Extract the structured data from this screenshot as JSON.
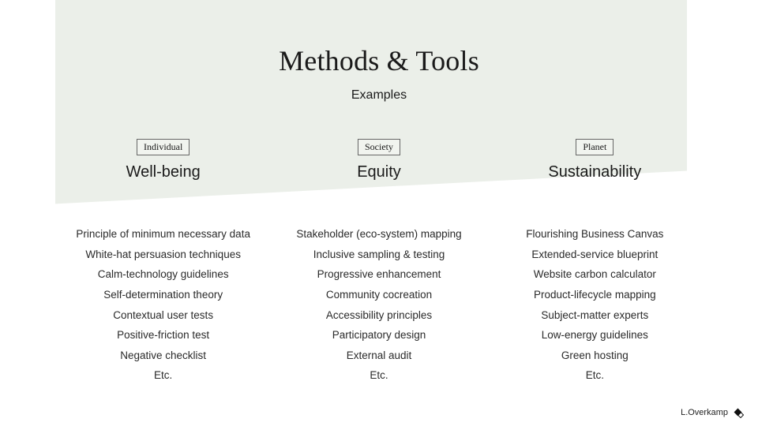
{
  "title": "Methods & Tools",
  "subtitle": "Examples",
  "columns": [
    {
      "tag": "Individual",
      "pillar": "Well-being",
      "items": [
        "Principle of minimum necessary data",
        "White-hat persuasion techniques",
        "Calm-technology guidelines",
        "Self-determination theory",
        "Contextual user tests",
        "Positive-friction test",
        "Negative checklist",
        "Etc."
      ]
    },
    {
      "tag": "Society",
      "pillar": "Equity",
      "items": [
        "Stakeholder (eco-system) mapping",
        "Inclusive sampling & testing",
        "Progressive enhancement",
        "Community cocreation",
        "Accessibility principles",
        "Participatory design",
        "External audit",
        "Etc."
      ]
    },
    {
      "tag": "Planet",
      "pillar": "Sustainability",
      "items": [
        "Flourishing Business Canvas",
        "Extended-service blueprint",
        "Website carbon calculator",
        "Product-lifecycle mapping",
        "Subject-matter experts",
        "Low-energy guidelines",
        "Green hosting",
        "Etc."
      ]
    }
  ],
  "footer": {
    "credit": "L.Overkamp"
  }
}
